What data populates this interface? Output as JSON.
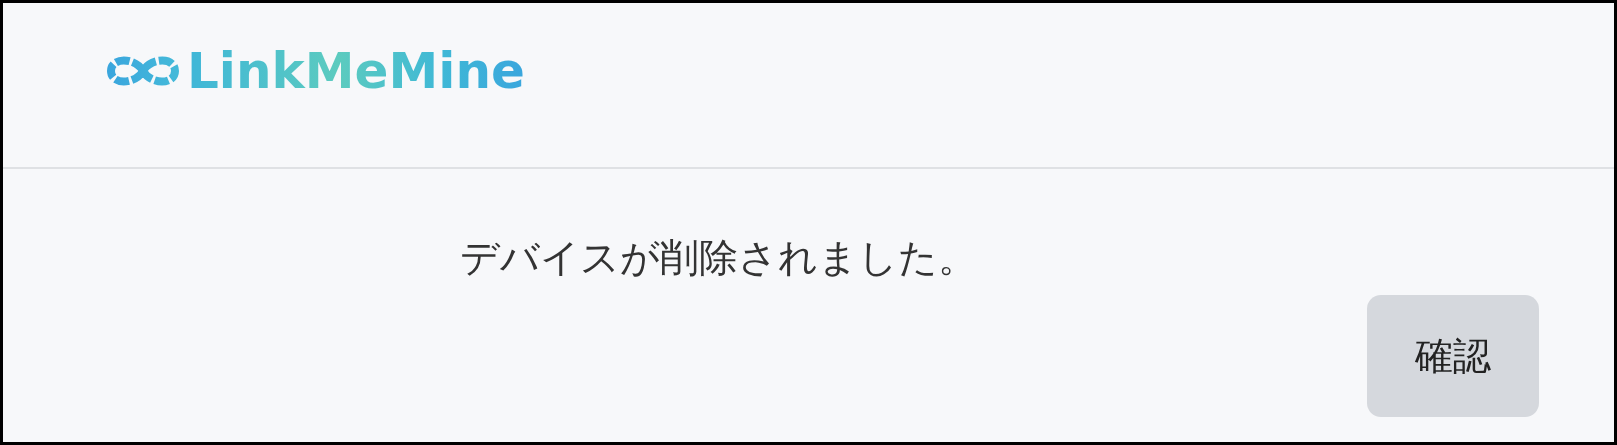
{
  "header": {
    "logo": "LinkMeMine"
  },
  "message": "デバイスが削除されました。",
  "buttons": [
    {
      "label": "確認"
    }
  ]
}
